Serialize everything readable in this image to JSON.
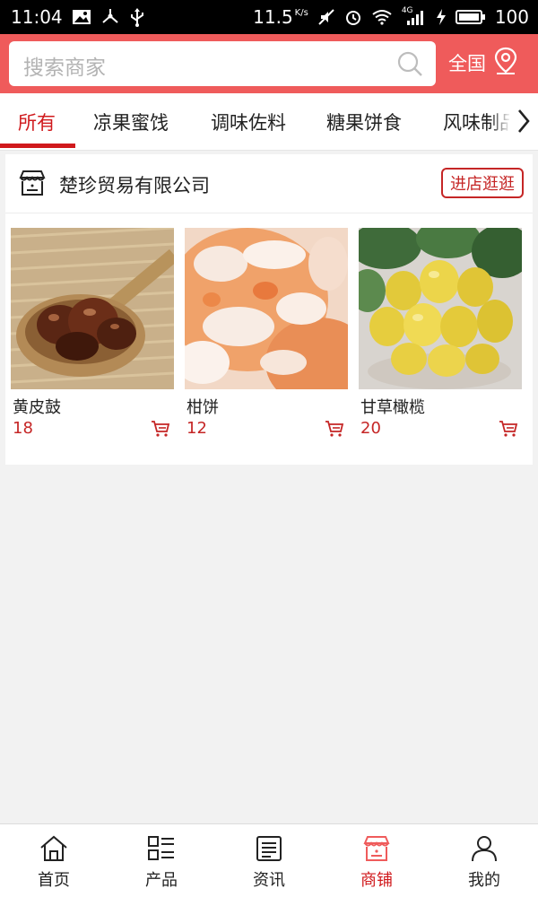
{
  "status_bar": {
    "time": "11:04",
    "net_speed": "11.5",
    "net_unit": "K/s",
    "signal_label": "4G",
    "battery": "100"
  },
  "search": {
    "placeholder": "搜索商家",
    "region_label": "全国"
  },
  "tabs": [
    {
      "label": "所有",
      "active": true
    },
    {
      "label": "凉果蜜饯",
      "active": false
    },
    {
      "label": "调味佐料",
      "active": false
    },
    {
      "label": "糖果饼食",
      "active": false
    },
    {
      "label": "风味制品",
      "active": false
    }
  ],
  "shop": {
    "name": "楚珍贸易有限公司",
    "visit_label": "进店逛逛",
    "products": [
      {
        "name": "黄皮鼓",
        "price": "18",
        "image": "dried-fruit-on-wooden-spoon"
      },
      {
        "name": "柑饼",
        "price": "12",
        "image": "sugared-dried-tangerine"
      },
      {
        "name": "甘草橄榄",
        "price": "20",
        "image": "licorice-olives"
      }
    ]
  },
  "bottom_nav": [
    {
      "label": "首页",
      "icon": "home-icon",
      "active": false
    },
    {
      "label": "产品",
      "icon": "product-list-icon",
      "active": false
    },
    {
      "label": "资讯",
      "icon": "news-icon",
      "active": false
    },
    {
      "label": "商铺",
      "icon": "shop-icon",
      "active": true
    },
    {
      "label": "我的",
      "icon": "user-icon",
      "active": false
    }
  ],
  "colors": {
    "brand": "#ef5b5b",
    "accent": "#d0191c",
    "price": "#c52626",
    "background": "#f2f2f2"
  }
}
